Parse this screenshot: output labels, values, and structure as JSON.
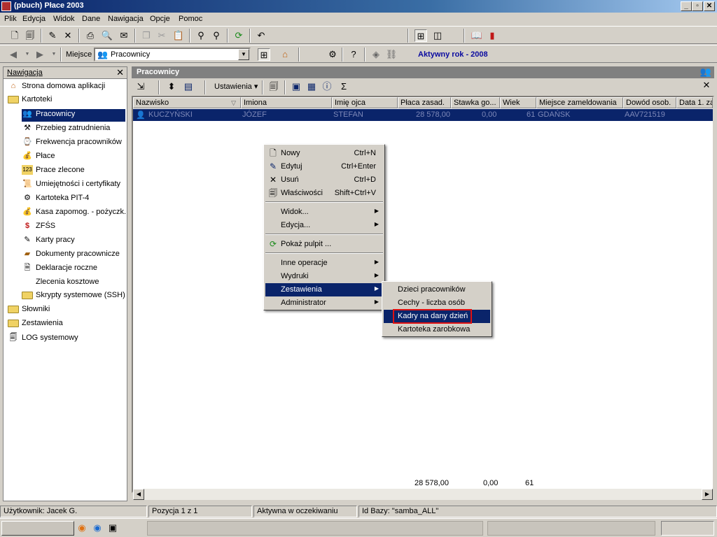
{
  "window": {
    "title": "(pbuch) Płace 2003"
  },
  "menubar": [
    "Plik",
    "Edycja",
    "Widok",
    "Dane",
    "Nawigacja",
    "Opcje",
    "Pomoc"
  ],
  "toolbar2": {
    "place_label": "Miejsce",
    "place_value": "Pracownicy",
    "active_year": "Aktywny rok - 2008"
  },
  "nav": {
    "title": "Nawigacja",
    "close": "✕",
    "items": [
      "Strona domowa aplikacji",
      "Kartoteki",
      "Pracownicy",
      "Przebieg zatrudnienia",
      "Frekwencja pracowników",
      "Płace",
      "Prace zlecone",
      "Umiejętności i certyfikaty",
      "Kartoteka PIT-4",
      "Kasa zapomog. - pożyczk.",
      "ZFŚS",
      "Karty pracy",
      "Dokumenty pracownicze",
      "Deklaracje roczne",
      "Zlecenia kosztowe",
      "Skrypty systemowe (SSH)",
      "Słowniki",
      "Zestawienia",
      "LOG systemowy"
    ]
  },
  "main": {
    "title": "Pracownicy",
    "settings_label": "Ustawienia",
    "columns": [
      "Nazwisko",
      "Imiona",
      "Imię ojca",
      "Płaca zasad.",
      "Stawka go...",
      "Wiek",
      "Miejsce zameldowania",
      "Dowód osob.",
      "Data 1. za"
    ],
    "row": [
      "KUCZYŃSKI",
      "JÓZEF",
      "STEFAN",
      "28 578,00",
      "0,00",
      "61",
      "GDAŃSK",
      "AAV721519"
    ],
    "totals": {
      "salary": "28 578,00",
      "rate": "0,00",
      "age": "61"
    }
  },
  "context_menu": {
    "items": [
      {
        "label": "Nowy",
        "shortcut": "Ctrl+N",
        "icon": "new-doc-icon"
      },
      {
        "label": "Edytuj",
        "shortcut": "Ctrl+Enter",
        "icon": "edit-icon"
      },
      {
        "label": "Usuń",
        "shortcut": "Ctrl+D",
        "icon": "delete-icon"
      },
      {
        "label": "Właściwości",
        "shortcut": "Shift+Ctrl+V",
        "icon": "properties-icon"
      },
      {
        "label": "Widok..."
      },
      {
        "label": "Edycja..."
      },
      {
        "label": "Pokaż pulpit ...",
        "icon": "desktop-icon"
      },
      {
        "label": "Inne operacje"
      },
      {
        "label": "Wydruki"
      },
      {
        "label": "Zestawienia"
      },
      {
        "label": "Administrator"
      }
    ],
    "submenu": [
      "Dzieci pracowników",
      "Cechy - liczba osób",
      "Kadry na dany dzień",
      "Kartoteka zarobkowa"
    ]
  },
  "statusbar": {
    "user": "Użytkownik: Jacek G.",
    "position": "Pozycja 1 z 1",
    "state": "Aktywna w oczekiwaniu",
    "db": "Id Bazy: \"samba_ALL\""
  },
  "colors": {
    "selection": "#0a246a",
    "highlight_box": "#e01010",
    "active_year": "#0a0aa0"
  }
}
